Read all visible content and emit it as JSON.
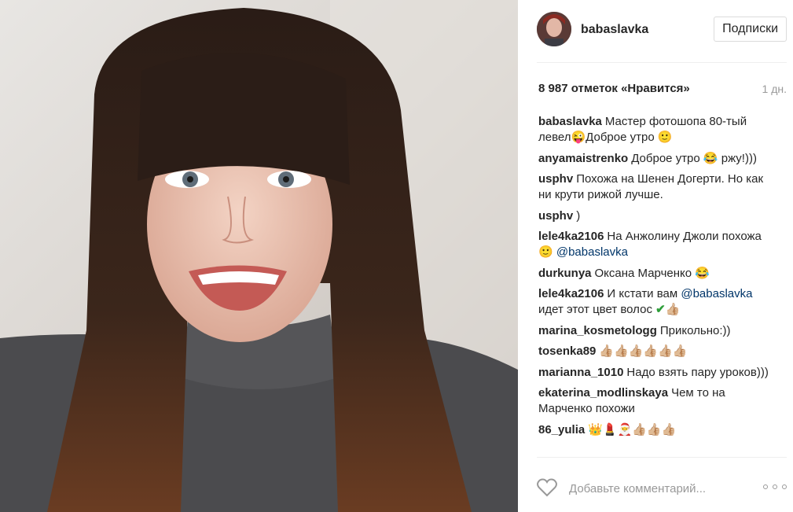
{
  "post": {
    "username": "babaslavka",
    "follow_label": "Подписки",
    "likes": "8 987 отметок «Нравится»",
    "time": "1 дн."
  },
  "comments": [
    {
      "user": "babaslavka",
      "text": "Мастер фотошопа 80-тый левел😜Доброе утро 🙂"
    },
    {
      "user": "anyamaistrenko",
      "text": "Доброе утро 😂 ржу!)))"
    },
    {
      "user": "usphv",
      "text": "Похожа на Шенен Догерти. Но как ни крути рижой лучше."
    },
    {
      "user": "usphv",
      "text": ")"
    },
    {
      "user": "lele4ka2106",
      "text": "На Анжолину Джоли похожа 🙂",
      "mention": "@babaslavka"
    },
    {
      "user": "durkunya",
      "text": "Оксана Марченко 😂"
    },
    {
      "user": "lele4ka2106",
      "text": "И кстати вам",
      "mention": "@babaslavka",
      "text2": "идет этот цвет волос",
      "check": "✔",
      "tail": "👍🏼"
    },
    {
      "user": "marina_kosmetologg",
      "text": "Прикольно:))"
    },
    {
      "user": "tosenka89",
      "text": "👍🏼👍🏼👍🏼👍🏼👍🏼👍🏼"
    },
    {
      "user": "marianna_1010",
      "text": "Надо взять пару уроков)))"
    },
    {
      "user": "ekaterina_modlinskaya",
      "text": "Чем то на Марченко похожи"
    },
    {
      "user": "86_yulia",
      "text": "👑💄🎅👍🏼👍🏼👍🏼"
    }
  ],
  "footer": {
    "comment_placeholder": "Добавьте комментарий..."
  },
  "colors": {
    "mention": "#003569",
    "muted": "#999999",
    "border": "#efefef"
  },
  "icons": {
    "like": "heart-icon",
    "more": "more-options-icon"
  }
}
